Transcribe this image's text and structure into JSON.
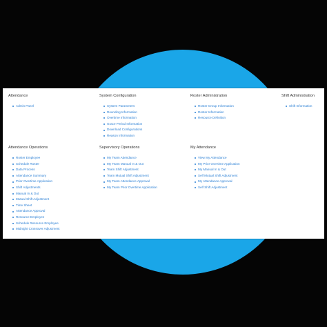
{
  "sections": [
    {
      "title": "Attendance",
      "items": [
        "Admin Panel"
      ]
    },
    {
      "title": "System Configuration",
      "items": [
        "System Parameters",
        "Rounding Information",
        "Overtime Information",
        "Grace Period Information",
        "Download Configurations",
        "Reason Information"
      ]
    },
    {
      "title": "Roster Administration",
      "items": [
        "Roster Group Information",
        "Roster Information",
        "Resource Definition"
      ]
    },
    {
      "title": "Shift Administration",
      "items": [
        "Shift Information"
      ]
    },
    {
      "title": "Attendance Operations",
      "items": [
        "Roster Employee",
        "Schedule Roster",
        "Data Process",
        "Attendance Summary",
        "Prior Overtime Application",
        "Shift Adjustments",
        "Manual In & Out",
        "Mutual Shift Adjustment",
        "Time Sheet",
        "Attendance Approval",
        "Resource Employee",
        "Schedule Resource Employee",
        "Midnight Crossover Adjustment"
      ]
    },
    {
      "title": "Supervisory Operations",
      "items": [
        "My Team Attendance",
        "My Team Manual In & Out",
        "Team Shift Adjustment",
        "Team Mutual Shift Adjustment",
        "My Team Attendance Approval",
        "My Team Prior Overtime Application"
      ]
    },
    {
      "title": "My Attendance",
      "items": [
        "View My Attendance",
        "My Prior Overtime Application",
        "My Manual In & Out",
        "Self Mutual Shift Adjustment",
        "My Attendance Approval",
        "Self Shift Adjustment"
      ]
    }
  ]
}
